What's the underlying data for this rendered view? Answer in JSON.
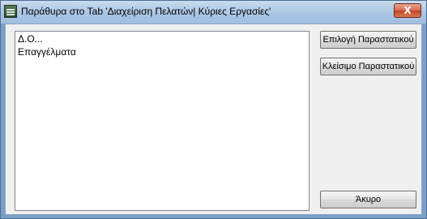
{
  "window": {
    "title": "Παράθυρα στο Tab 'Διαχείριση Πελατών| Κύριες Εργασίες'",
    "close_label": "X"
  },
  "list": {
    "items": [
      {
        "label": "Δ.Ο..."
      },
      {
        "label": "Επαγγέλματα"
      }
    ]
  },
  "buttons": {
    "select_label": "Επιλογή Παραστατικού",
    "close_label": "Κλείσιμο Παραστατικού",
    "cancel_label": "Άκυρο"
  }
}
